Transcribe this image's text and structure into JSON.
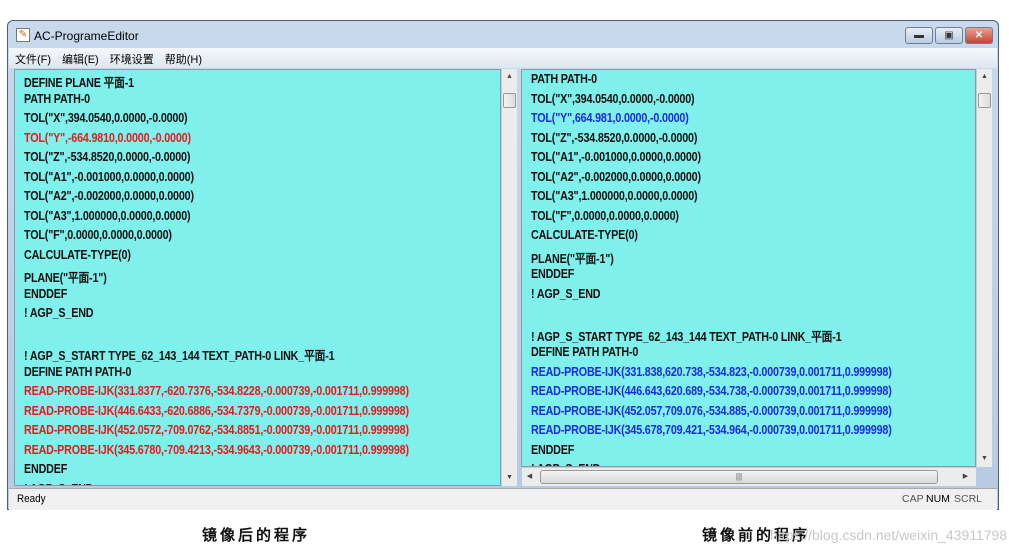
{
  "window": {
    "title": "AC-ProgrameEditor",
    "icon": "edit-document-icon"
  },
  "menu": [
    "文件(F)",
    "编辑(E)",
    "环境设置",
    "帮助(H)"
  ],
  "left_pane": {
    "lines": [
      {
        "t": "DEFINE PLANE 平面-1",
        "c": "k"
      },
      {
        "t": "PATH PATH-0",
        "c": "k"
      },
      {
        "t": "TOL(\"X\",394.0540,0.0000,-0.0000)",
        "c": "k"
      },
      {
        "t": "TOL(\"Y\",-664.9810,0.0000,-0.0000)",
        "c": "r"
      },
      {
        "t": "TOL(\"Z\",-534.8520,0.0000,-0.0000)",
        "c": "k"
      },
      {
        "t": "TOL(\"A1\",-0.001000,0.0000,0.0000)",
        "c": "k"
      },
      {
        "t": "TOL(\"A2\",-0.002000,0.0000,0.0000)",
        "c": "k"
      },
      {
        "t": "TOL(\"A3\",1.000000,0.0000,0.0000)",
        "c": "k"
      },
      {
        "t": "TOL(\"F\",0.0000,0.0000,0.0000)",
        "c": "k"
      },
      {
        "t": "CALCULATE-TYPE(0)",
        "c": "k"
      },
      {
        "t": "PLANE(\"平面-1\")",
        "c": "k"
      },
      {
        "t": "ENDDEF",
        "c": "k"
      },
      {
        "t": "! AGP_S_END",
        "c": "k"
      },
      {
        "t": "",
        "c": "k"
      },
      {
        "t": "! AGP_S_START TYPE_62_143_144 TEXT_PATH-0 LINK_平面-1",
        "c": "k"
      },
      {
        "t": "DEFINE PATH PATH-0",
        "c": "k"
      },
      {
        "t": "READ-PROBE-IJK(331.8377,-620.7376,-534.8228,-0.000739,-0.001711,0.999998)",
        "c": "r"
      },
      {
        "t": "READ-PROBE-IJK(446.6433,-620.6886,-534.7379,-0.000739,-0.001711,0.999998)",
        "c": "r"
      },
      {
        "t": "READ-PROBE-IJK(452.0572,-709.0762,-534.8851,-0.000739,-0.001711,0.999998)",
        "c": "r"
      },
      {
        "t": "READ-PROBE-IJK(345.6780,-709.4213,-534.9643,-0.000739,-0.001711,0.999998)",
        "c": "r"
      },
      {
        "t": "ENDDEF",
        "c": "k"
      },
      {
        "t": "! AGP_S_END",
        "c": "k"
      }
    ]
  },
  "right_pane": {
    "lines": [
      {
        "t": "PATH PATH-0",
        "c": "k"
      },
      {
        "t": "TOL(\"X\",394.0540,0.0000,-0.0000)",
        "c": "k"
      },
      {
        "t": "TOL(\"Y\",664.981,0.0000,-0.0000)",
        "c": "b"
      },
      {
        "t": "TOL(\"Z\",-534.8520,0.0000,-0.0000)",
        "c": "k"
      },
      {
        "t": "TOL(\"A1\",-0.001000,0.0000,0.0000)",
        "c": "k"
      },
      {
        "t": "TOL(\"A2\",-0.002000,0.0000,0.0000)",
        "c": "k"
      },
      {
        "t": "TOL(\"A3\",1.000000,0.0000,0.0000)",
        "c": "k"
      },
      {
        "t": "TOL(\"F\",0.0000,0.0000,0.0000)",
        "c": "k"
      },
      {
        "t": "CALCULATE-TYPE(0)",
        "c": "k"
      },
      {
        "t": "PLANE(\"平面-1\")",
        "c": "k"
      },
      {
        "t": "ENDDEF",
        "c": "k"
      },
      {
        "t": "! AGP_S_END",
        "c": "k"
      },
      {
        "t": "",
        "c": "k"
      },
      {
        "t": "! AGP_S_START TYPE_62_143_144 TEXT_PATH-0 LINK_平面-1",
        "c": "k"
      },
      {
        "t": "DEFINE PATH PATH-0",
        "c": "k"
      },
      {
        "t": "READ-PROBE-IJK(331.838,620.738,-534.823,-0.000739,0.001711,0.999998)",
        "c": "b"
      },
      {
        "t": "READ-PROBE-IJK(446.643,620.689,-534.738,-0.000739,0.001711,0.999998)",
        "c": "b"
      },
      {
        "t": "READ-PROBE-IJK(452.057,709.076,-534.885,-0.000739,0.001711,0.999998)",
        "c": "b"
      },
      {
        "t": "READ-PROBE-IJK(345.678,709.421,-534.964,-0.000739,0.001711,0.999998)",
        "c": "b"
      },
      {
        "t": "ENDDEF",
        "c": "k"
      },
      {
        "t": "! AGP_S_END",
        "c": "k"
      }
    ]
  },
  "status": {
    "text": "Ready",
    "indicators": [
      "CAP",
      "NUM",
      "SCRL"
    ]
  },
  "captions": {
    "left": "镜像后的程序",
    "right": "镜像前的程序"
  },
  "watermark": "https://blog.csdn.net/weixin_43911798",
  "colors": {
    "editor_bg": "#7ff0ec",
    "changed_after": "#e31b1b",
    "changed_before": "#1a2be0"
  }
}
